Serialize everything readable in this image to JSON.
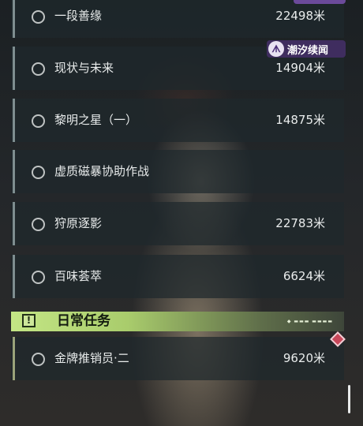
{
  "quests": [
    {
      "name": "一段善缘",
      "distance": "22498米"
    },
    {
      "name": "现状与未来",
      "distance": "14904米"
    },
    {
      "name": "黎明之星（一）",
      "distance": "14875米"
    },
    {
      "name": "虚质磁暴协助作战",
      "distance": ""
    },
    {
      "name": "狩原逐影",
      "distance": "22783米"
    },
    {
      "name": "百味荟萃",
      "distance": "6624米"
    }
  ],
  "daily_section": {
    "title": "日常任务",
    "icon": "exclamation-icon",
    "quests": [
      {
        "name": "金牌推销员·二",
        "distance": "9620米"
      }
    ]
  },
  "watermark": {
    "logo": "ᗑ",
    "text": "潮汐续闻"
  },
  "colors": {
    "section_accent": "#c4e685",
    "row_bar": "#7e8e90",
    "pin_marker": "#c8475a",
    "watermark_bg": "#3f2d5f"
  }
}
